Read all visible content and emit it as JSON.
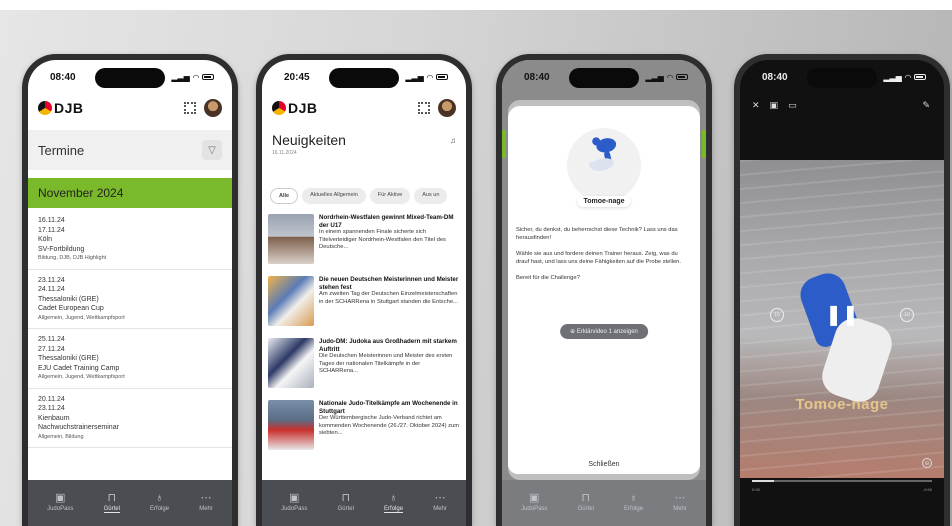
{
  "phone1": {
    "time": "08:40",
    "logo": "DJB",
    "section_title": "Termine",
    "month": "November 2024",
    "events": [
      {
        "start": "16.11.24",
        "end": "17.11.24",
        "place": "Köln",
        "name": "SV-Fortbildung",
        "tags": "Bildung, DJB, DJB Highlight"
      },
      {
        "start": "23.11.24",
        "end": "24.11.24",
        "place": "Thessaloniki (GRE)",
        "name": "Cadet European Cup",
        "tags": "Allgemein, Jugend, Wettkampfsport"
      },
      {
        "start": "25.11.24",
        "end": "27.11.24",
        "place": "Thessaloniki (GRE)",
        "name": "EJU Cadet Training Camp",
        "tags": "Allgemein, Jugend, Wettkampfsport"
      },
      {
        "start": "20.11.24",
        "end": "23.11.24",
        "place": "Kienbaum",
        "name": "Nachwuchstrainerseminar",
        "tags": "Allgemein, Bildung"
      }
    ]
  },
  "phone2": {
    "time": "20:45",
    "logo": "DJB",
    "title": "Neuigkeiten",
    "date": "16.11.2024",
    "chips": [
      "Alle",
      "Aktuelles Allgemein",
      "Für Aktive",
      "Aus un"
    ],
    "news": [
      {
        "title": "Nordrhein-Westfalen gewinnt Mixed-Team-DM der U17",
        "text": "In einem spannenden Finale sicherte sich Titelverteidiger Nordrhein-Westfalen den Titel des Deutsche..."
      },
      {
        "title": "Die neuen Deutschen Meisterinnen und Meister stehen fest",
        "text": "Am zweiten Tag der Deutschen Einzelmeisterschaften in der SCHARRena in Stuttgart standen die Entsche..."
      },
      {
        "title": "Judo-DM: Judoka aus Großhadern mit starkem Auftritt",
        "text": "Die Deutschen Meisterinnen und Meister des ersten Tages der nationalen Titelkämpfe in der SCHARRena..."
      },
      {
        "title": "Nationale Judo-Titelkämpfe am Wochenende in Stuttgart",
        "text": "Der Württembergische Judo-Verband richtet am kommenden Wochenende (26./27. Oktober 2024) zum siebten..."
      }
    ]
  },
  "phone3": {
    "time": "08:40",
    "technique": "Tomoe-nage",
    "para1": "Sicher, du denkst, du beherrschst diese Technik? Lass uns das herausfinden!",
    "para2": "Wähle sie aus und fordere deinen Trainer heraus. Zeig, was du drauf hast, und lass uns deine Fähigkeiten auf die Probe stellen.",
    "para3": "Bereit für die Challenge?",
    "video_button": "Erklärvideo 1 anzeigen",
    "close_button": "Schließen"
  },
  "phone4": {
    "time": "08:40",
    "overlay_title": "Tomoe-nage",
    "progress": 0.12,
    "skip_back": "10",
    "skip_forward": "10",
    "time_elapsed": "0:08",
    "time_remaining": "-0:50"
  },
  "tabs": [
    {
      "label": "JudoPass",
      "icon": "id-card-icon",
      "glyph": "▣"
    },
    {
      "label": "Gürtel",
      "icon": "belt-icon",
      "glyph": "⊓"
    },
    {
      "label": "Erfolge",
      "icon": "trophy-icon",
      "glyph": "♁"
    },
    {
      "label": "Mehr",
      "icon": "more-icon",
      "glyph": "⋯"
    }
  ],
  "colors": {
    "accent_green": "#7ab929",
    "tabbar": "#4a4d52",
    "overlay_gold": "#e6c58a"
  }
}
